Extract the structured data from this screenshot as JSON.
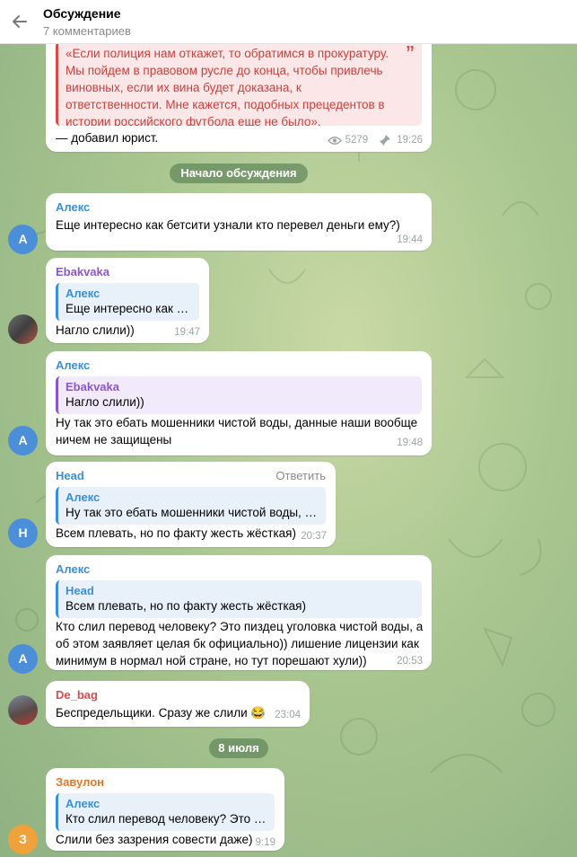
{
  "header": {
    "title": "Обсуждение",
    "subtitle": "7 комментариев"
  },
  "post": {
    "quote_text": "«Если полиция нам откажет, то обратимся в прокуратуру. Мы пойдем в правовом русле до конца, чтобы привлечь виновных, если их вина будет доказана, к ответственности. Мне кажется, подобных прецедентов в истории российского футбола еще не было»,",
    "tail_text": "— добавил юрист.",
    "views": "5279",
    "time": "19:26"
  },
  "dividers": {
    "discussion_start": "Начало обсуждения",
    "date": "8 июля"
  },
  "messages": [
    {
      "author": "Алекс",
      "avatar_letter": "A",
      "avatar_color": "#4a8fd8",
      "text": "Еще интересно как бетсити узнали кто перевел деньги ему?)",
      "time": "19:44"
    },
    {
      "author": "Ebakvaka",
      "reply_author": "Алекс",
      "reply_text": "Еще интересно как б...",
      "text": "Нагло слили))",
      "time": "19:47"
    },
    {
      "author": "Алекс",
      "avatar_letter": "A",
      "reply_author": "Ebakvaka",
      "reply_text": "Нагло слили))",
      "text": "Ну так это ебать мошенники чистой воды, данные наши вообще ничем не защищены",
      "time": "19:48"
    },
    {
      "author": "Head",
      "avatar_letter": "H",
      "reply_label": "Ответить",
      "reply_author": "Алекс",
      "reply_text": "Ну так это ебать мошенники чистой воды, д...",
      "text": "Всем плевать, но по факту жесть жёсткая)",
      "time": "20:37"
    },
    {
      "author": "Алекс",
      "avatar_letter": "A",
      "reply_author": "Head",
      "reply_text": "Всем плевать, но по факту жесть жёсткая)",
      "text": "Кто слил перевод человеку? Это пиздец уголовка чистой воды, а об этом заявляет целая бк официально)) лишение лицензии как минимум в нормал ной стране, но тут порешают хули))",
      "time": "20:53"
    },
    {
      "author": "De_bag",
      "text": "Беспредельщики. Сразу же слили 😂",
      "time": "23:04"
    },
    {
      "author": "Завулон",
      "avatar_letter": "З",
      "avatar_color": "#f0a13a",
      "reply_author": "Алекс",
      "reply_text": "Кто слил перевод человеку? Это пи...",
      "text": "Слили без зазрения совести даже)",
      "time": "9:19"
    }
  ]
}
